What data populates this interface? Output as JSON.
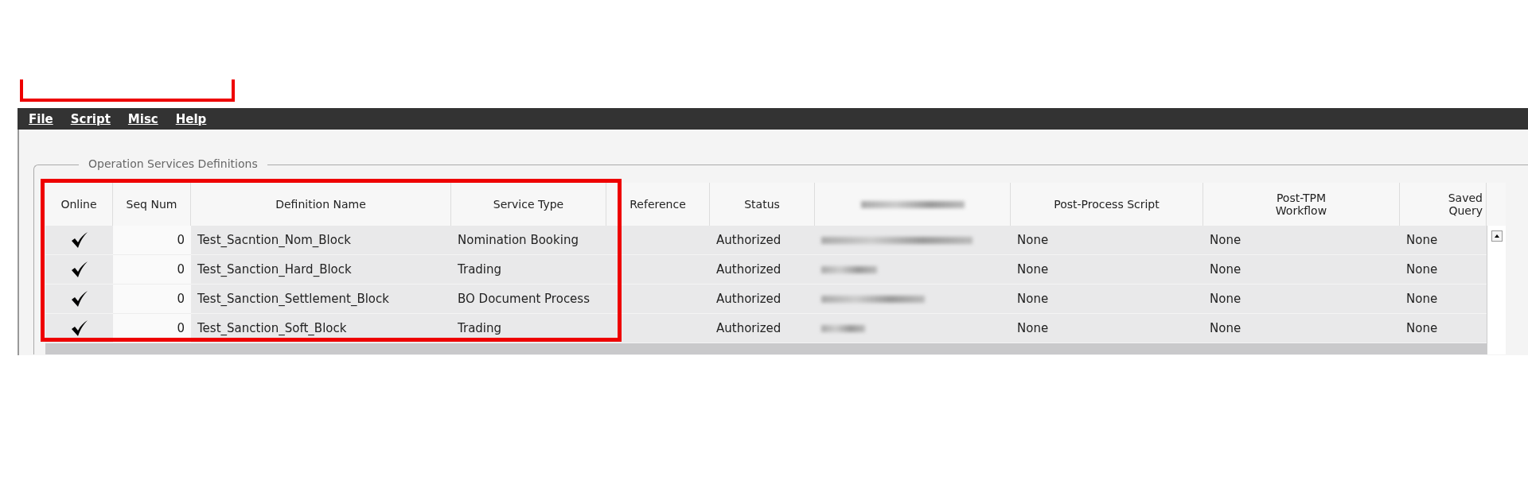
{
  "menu": [
    {
      "label": "File"
    },
    {
      "label": "Script"
    },
    {
      "label": "Misc"
    },
    {
      "label": "Help"
    }
  ],
  "group_title": "Operation Services Definitions",
  "table": {
    "columns": [
      "Online",
      "Seq Num",
      "Definition Name",
      "Service Type",
      "Reference",
      "Status",
      null,
      "Post-Process Script",
      "Post-TPM Workflow",
      "Saved Query"
    ],
    "rows": [
      {
        "online": true,
        "seq_num": "0",
        "definition_name": "Test_Sacntion_Nom_Block",
        "service_type": "Nomination Booking",
        "status": "Authorized",
        "post_process_script": "None",
        "post_tpm_workflow": "None",
        "saved_query": "None"
      },
      {
        "online": true,
        "seq_num": "0",
        "definition_name": "Test_Sanction_Hard_Block",
        "service_type": "Trading",
        "status": "Authorized",
        "post_process_script": "None",
        "post_tpm_workflow": "None",
        "saved_query": "None"
      },
      {
        "online": true,
        "seq_num": "0",
        "definition_name": "Test_Sanction_Settlement_Block",
        "service_type": "BO Document Process",
        "status": "Authorized",
        "post_process_script": "None",
        "post_tpm_workflow": "None",
        "saved_query": "None"
      },
      {
        "online": true,
        "seq_num": "0",
        "definition_name": "Test_Sanction_Soft_Block",
        "service_type": "Trading",
        "status": "Authorized",
        "post_process_script": "None",
        "post_tpm_workflow": "None",
        "saved_query": "None"
      }
    ]
  }
}
